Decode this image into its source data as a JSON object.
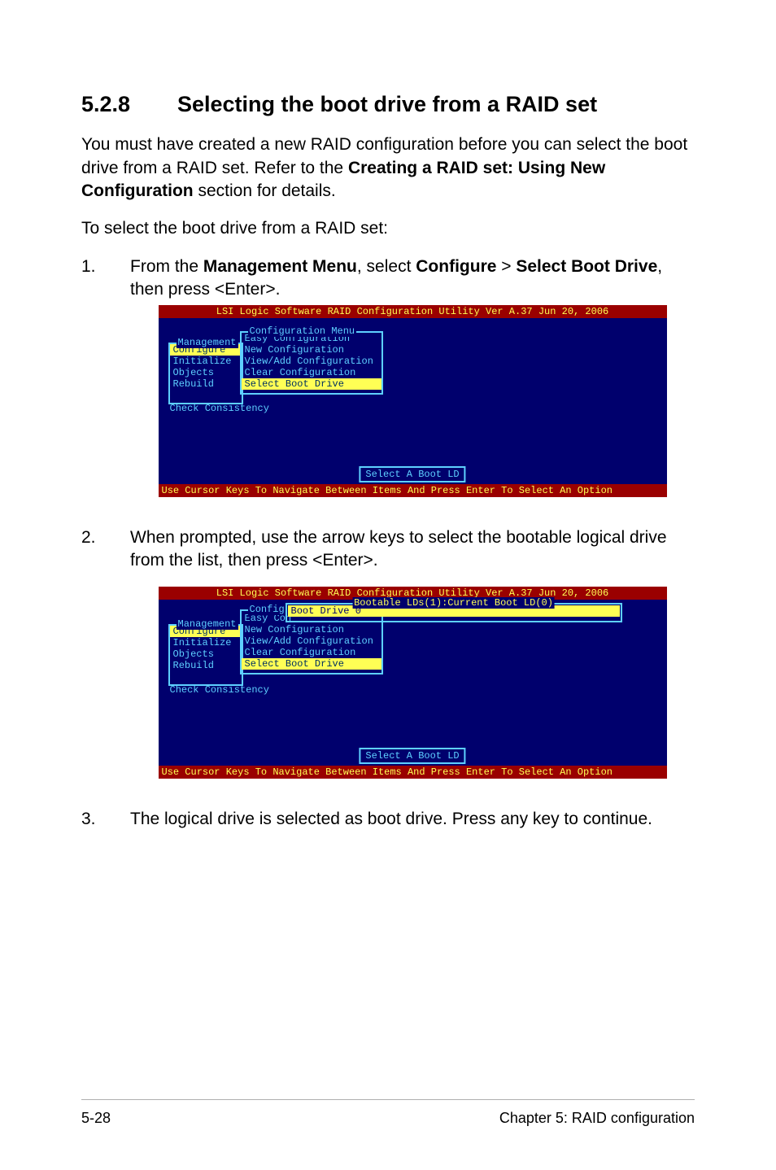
{
  "heading": {
    "number": "5.2.8",
    "title": "Selecting the boot drive from a RAID set"
  },
  "para1_a": "You must have created a new RAID configuration before you can select the boot drive from a RAID set. Refer to the ",
  "para1_b": "Creating a RAID set: Using New Configuration",
  "para1_c": " section for details.",
  "para2": "To select the boot drive from a RAID set:",
  "steps": [
    {
      "n": "1.",
      "a": "From the ",
      "b": "Management Menu",
      "c": ", select ",
      "d": "Configure",
      "e": " > ",
      "f": "Select Boot Drive",
      "g": ", then press <Enter>."
    },
    {
      "n": "2.",
      "text": "When prompted, use the arrow keys to select the bootable logical drive from the list, then press <Enter>."
    },
    {
      "n": "3.",
      "text": "The logical drive is selected as boot drive. Press any key to continue."
    }
  ],
  "bios_common": {
    "title": "LSI Logic Software RAID Configuration Utility Ver A.37 Jun 20, 2006",
    "hint": "Use Cursor Keys To Navigate Between Items And Press Enter To Select An Option",
    "mgmt_title": "Management",
    "mgmt_items": [
      "Configure",
      "Initialize",
      "Objects",
      "Rebuild",
      "Check Consistency"
    ],
    "cfg_title": "Configuration Menu",
    "cfg_items": [
      "Easy Configuration",
      "New Configuration",
      "View/Add Configuration",
      "Clear Configuration",
      "Select Boot Drive"
    ],
    "popup": "Select A Boot LD"
  },
  "bios1": {
    "mgmt_sel_index": 0,
    "cfg_sel_index": 4
  },
  "bios2": {
    "cfg_title_short": "Config",
    "easy_short": "Easy Con",
    "boot_panel_title": "Bootable LDs(1):Current Boot LD(0)",
    "boot_item": "Boot Drive 0"
  },
  "footer": {
    "left": "5-28",
    "right": "Chapter 5: RAID configuration"
  }
}
